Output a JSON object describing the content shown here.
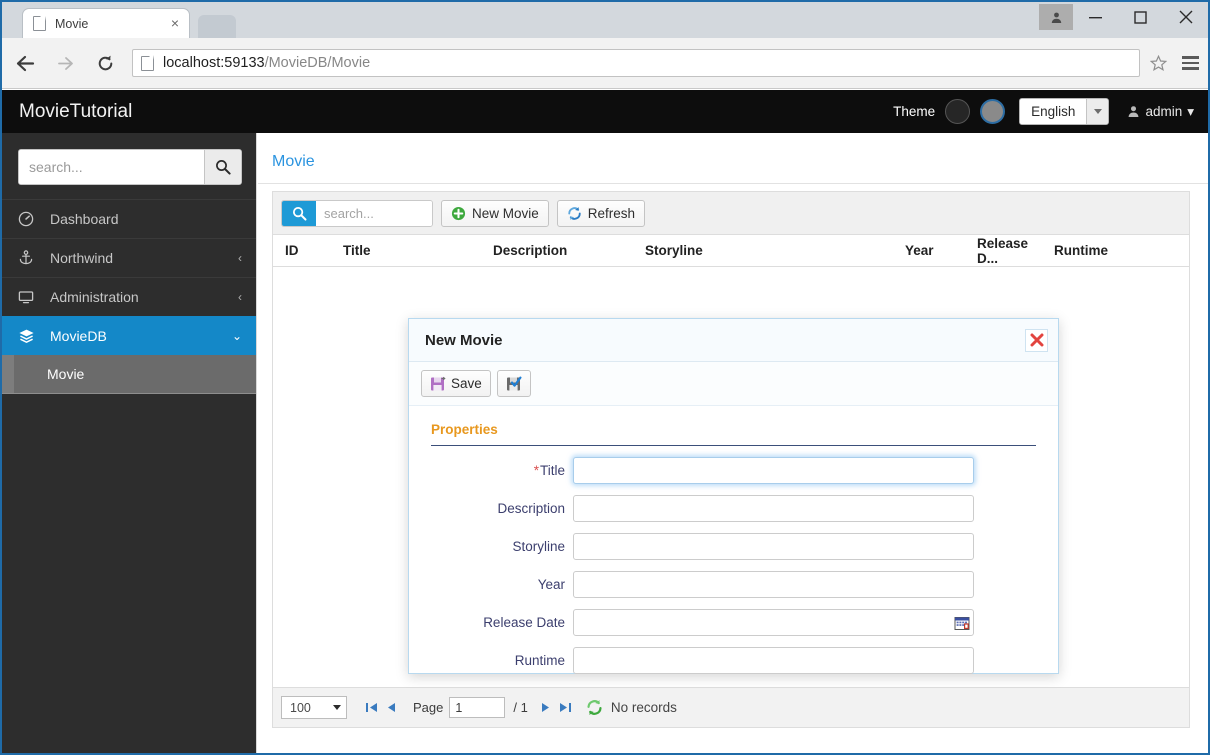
{
  "browser": {
    "tab_title": "Movie",
    "tab_close_glyph": "×",
    "url_host": "localhost:59133",
    "url_path": "/MovieDB/Movie",
    "icons": {
      "back": "back-arrow-icon",
      "forward": "forward-arrow-icon",
      "reload": "reload-icon",
      "page": "page-icon",
      "bookmark": "star-icon",
      "menu": "hamburger-menu-icon",
      "profile": "profile-icon",
      "minimize": "minimize-icon",
      "maximize": "maximize-icon",
      "close": "close-icon"
    }
  },
  "header": {
    "brand": "MovieTutorial",
    "theme_label": "Theme",
    "theme_dark_name": "theme-dark-swatch",
    "theme_gray_name": "theme-gray-swatch",
    "language": "English",
    "user": "admin",
    "user_caret": "▾"
  },
  "sidebar": {
    "search_placeholder": "search...",
    "search_value": "",
    "items": [
      {
        "label": "Dashboard",
        "icon": "dashboard-icon",
        "arrow": "",
        "active": false
      },
      {
        "label": "Northwind",
        "icon": "anchor-icon",
        "arrow": "‹",
        "active": false
      },
      {
        "label": "Administration",
        "icon": "monitor-icon",
        "arrow": "‹",
        "active": false
      },
      {
        "label": "MovieDB",
        "icon": "layers-icon",
        "arrow": "⌄",
        "active": true
      }
    ],
    "sub_items": [
      {
        "label": "Movie"
      }
    ]
  },
  "main": {
    "page_title": "Movie",
    "toolbar": {
      "search_placeholder": "search...",
      "search_value": "",
      "new_label": "New Movie",
      "refresh_label": "Refresh"
    },
    "grid": {
      "columns": [
        "ID",
        "Title",
        "Description",
        "Storyline",
        "Year",
        "Release D...",
        "Runtime"
      ],
      "rows": []
    },
    "footer": {
      "page_size": "100",
      "page_label": "Page",
      "page_number": "1",
      "page_total": "/ 1",
      "status": "No records",
      "first_icon": "first-page-icon",
      "prev_icon": "previous-page-icon",
      "next_icon": "next-page-icon",
      "last_icon": "last-page-icon",
      "refresh_icon": "refresh-icon"
    }
  },
  "dialog": {
    "title": "New Movie",
    "close_name": "dialog-close-icon",
    "save_label": "Save",
    "save_icon": "save-floppy-icon",
    "apply_icon": "save-and-close-floppy-icon",
    "category": "Properties",
    "fields": [
      {
        "label": "Title",
        "required": true,
        "value": "",
        "type": "text",
        "focused": true
      },
      {
        "label": "Description",
        "required": false,
        "value": "",
        "type": "text",
        "focused": false
      },
      {
        "label": "Storyline",
        "required": false,
        "value": "",
        "type": "text",
        "focused": false
      },
      {
        "label": "Year",
        "required": false,
        "value": "",
        "type": "text",
        "focused": false
      },
      {
        "label": "Release Date",
        "required": false,
        "value": "",
        "type": "date",
        "focused": false
      },
      {
        "label": "Runtime",
        "required": false,
        "value": "",
        "type": "text",
        "focused": false
      }
    ]
  },
  "colors": {
    "accent_blue": "#1488c8",
    "link_blue": "#2b94e0",
    "header_black": "#0d0d0d",
    "sidebar_dark": "#2d2d2d",
    "category_orange": "#e8981f",
    "required_red": "#d94f4f"
  }
}
